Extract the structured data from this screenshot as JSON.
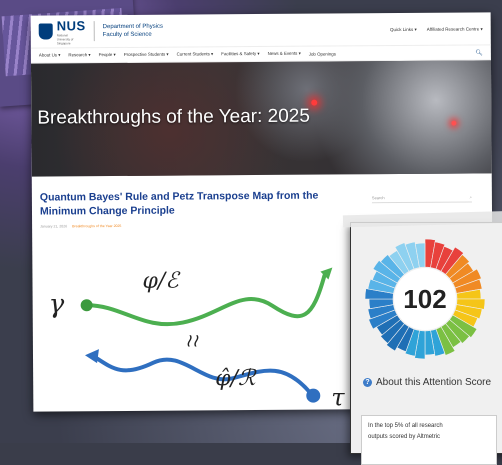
{
  "header": {
    "logo_text": "NUS",
    "logo_sub": "National University of Singapore",
    "department": "Department of Physics",
    "faculty": "Faculty of Science",
    "top_links": [
      "Quick Links ▾",
      "Affiliated Research Centre ▾"
    ]
  },
  "nav": {
    "items": [
      "About Us ▾",
      "Research ▾",
      "People ▾",
      "Prospective Students ▾",
      "Current Students ▾",
      "Facilities & Safety ▾",
      "News & Events ▾",
      "Job Openings"
    ]
  },
  "hero": {
    "title": "Breakthroughs of the Year: 2025"
  },
  "article": {
    "title": "Quantum Bayes' Rule and Petz Transpose Map from the Minimum Change Principle",
    "date": "January 21, 2026",
    "category": "Breakthroughs of the Year 2025"
  },
  "sidebar": {
    "search_placeholder": "Search"
  },
  "figure": {
    "gamma": "γ",
    "tau": "τ",
    "forward_map": "φ/ℰ",
    "reverse_map": "φ̂/ℛ",
    "approx": "≀≀"
  },
  "altmetric": {
    "score": "102",
    "about_label": "About this Attention Score",
    "summary_line1": "In the top 5% of all research",
    "summary_line2": "outputs scored by Altmetric",
    "colors": [
      "#e8413c",
      "#f08a24",
      "#f5c518",
      "#7bc043",
      "#2fa3d8",
      "#1f6fb5",
      "#2b7fc8",
      "#59b4e8",
      "#8ed1f0"
    ]
  },
  "colors": {
    "nus_blue": "#003d7c",
    "title_blue": "#1a3f8f",
    "category_orange": "#f08a24",
    "green_path": "#4caf50",
    "blue_path": "#2f6fc0"
  }
}
